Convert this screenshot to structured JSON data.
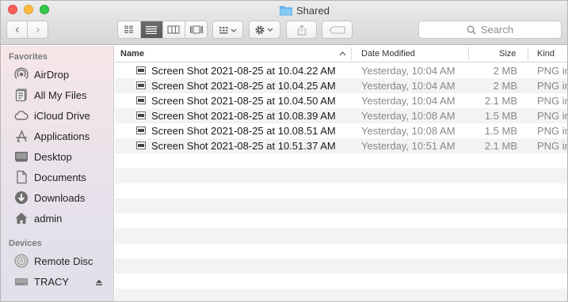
{
  "window": {
    "title": "Shared"
  },
  "toolbar": {
    "back_glyph": "‹",
    "forward_glyph": "›",
    "search_placeholder": "Search"
  },
  "sidebar": {
    "favorites_label": "Favorites",
    "favorites": [
      {
        "label": "AirDrop",
        "icon": "airdrop-icon"
      },
      {
        "label": "All My Files",
        "icon": "all-files-icon"
      },
      {
        "label": "iCloud Drive",
        "icon": "cloud-icon"
      },
      {
        "label": "Applications",
        "icon": "applications-icon"
      },
      {
        "label": "Desktop",
        "icon": "desktop-icon"
      },
      {
        "label": "Documents",
        "icon": "documents-icon"
      },
      {
        "label": "Downloads",
        "icon": "downloads-icon"
      },
      {
        "label": "admin",
        "icon": "home-icon"
      }
    ],
    "devices_label": "Devices",
    "devices": [
      {
        "label": "Remote Disc",
        "icon": "disc-icon"
      },
      {
        "label": "TRACY",
        "icon": "drive-icon"
      }
    ]
  },
  "columns": {
    "name": "Name",
    "date": "Date Modified",
    "size": "Size",
    "kind": "Kind"
  },
  "files": [
    {
      "name": "Screen Shot 2021-08-25 at 10.04.22 AM",
      "date": "Yesterday, 10:04 AM",
      "size": "2 MB",
      "kind": "PNG im"
    },
    {
      "name": "Screen Shot 2021-08-25 at 10.04.25 AM",
      "date": "Yesterday, 10:04 AM",
      "size": "2 MB",
      "kind": "PNG im"
    },
    {
      "name": "Screen Shot 2021-08-25 at 10.04.50 AM",
      "date": "Yesterday, 10:04 AM",
      "size": "2.1 MB",
      "kind": "PNG im"
    },
    {
      "name": "Screen Shot 2021-08-25 at 10.08.39 AM",
      "date": "Yesterday, 10:08 AM",
      "size": "1.5 MB",
      "kind": "PNG im"
    },
    {
      "name": "Screen Shot 2021-08-25 at 10.08.51 AM",
      "date": "Yesterday, 10:08 AM",
      "size": "1.5 MB",
      "kind": "PNG im"
    },
    {
      "name": "Screen Shot 2021-08-25 at 10.51.37 AM",
      "date": "Yesterday, 10:51 AM",
      "size": "2.1 MB",
      "kind": "PNG im"
    }
  ],
  "colors": {
    "accent_folder": "#5aaef0",
    "sidebar_icon": "#6e6e6e",
    "selected_view": "#5f5f5f"
  }
}
